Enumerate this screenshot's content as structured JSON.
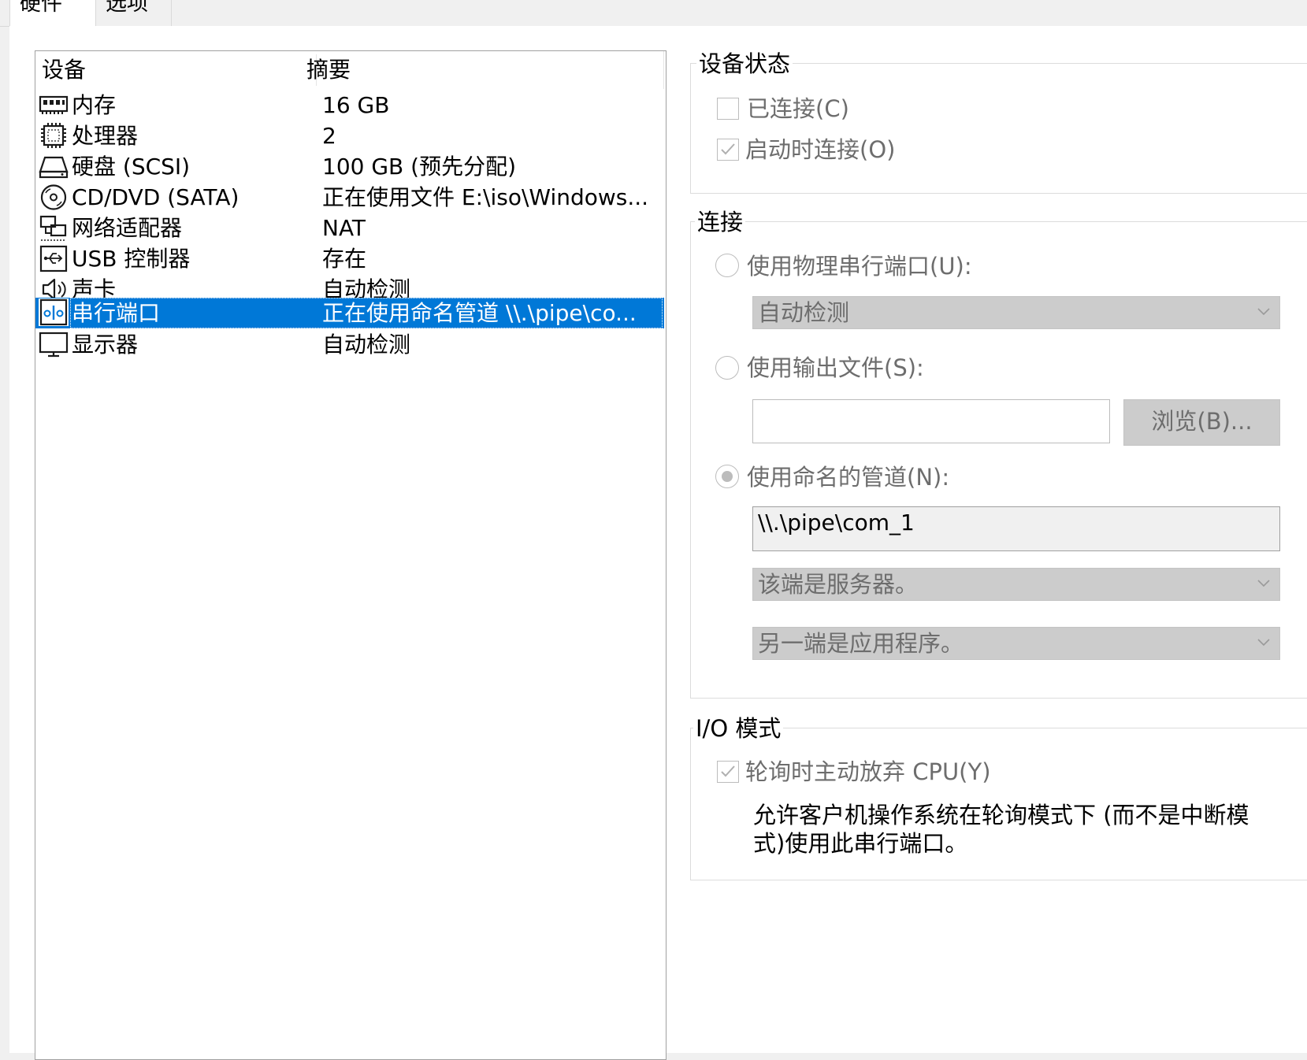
{
  "tabs": {
    "hardware": "硬件",
    "options": "选项"
  },
  "device_list": {
    "col_device": "设备",
    "col_summary": "摘要",
    "items": [
      {
        "name": "内存",
        "summary": "16 GB",
        "icon": "memory-icon"
      },
      {
        "name": "处理器",
        "summary": "2",
        "icon": "processor-icon"
      },
      {
        "name": "硬盘 (SCSI)",
        "summary": "100 GB (预先分配)",
        "icon": "hard-disk-icon"
      },
      {
        "name": "CD/DVD (SATA)",
        "summary": "正在使用文件 E:\\iso\\Windows...",
        "icon": "cd-dvd-icon"
      },
      {
        "name": "网络适配器",
        "summary": "NAT",
        "icon": "network-adapter-icon"
      },
      {
        "name": "USB 控制器",
        "summary": "存在",
        "icon": "usb-icon"
      },
      {
        "name": "声卡",
        "summary": "自动检测",
        "icon": "speaker-icon"
      },
      {
        "name": "串行端口",
        "summary": "正在使用命名管道 \\\\.\\pipe\\co...",
        "icon": "serial-port-icon",
        "selected": true
      },
      {
        "name": "显示器",
        "summary": "自动检测",
        "icon": "display-icon"
      }
    ]
  },
  "device_status": {
    "legend": "设备状态",
    "connected": {
      "label": "已连接(C)",
      "checked": false
    },
    "connect_at_power_on": {
      "label": "启动时连接(O)",
      "checked": true
    }
  },
  "connection": {
    "legend": "连接",
    "physical_port": {
      "label": "使用物理串行端口(U):",
      "selected": false,
      "combo_value": "自动检测"
    },
    "output_file": {
      "label": "使用输出文件(S):",
      "selected": false,
      "path": "",
      "browse_label": "浏览(B)..."
    },
    "named_pipe": {
      "label": "使用命名的管道(N):",
      "selected": true,
      "pipe_name": "\\\\.\\pipe\\com_1",
      "this_end": "该端是服务器。",
      "other_end": "另一端是应用程序。"
    }
  },
  "io_mode": {
    "legend": "I/O 模式",
    "yield_cpu": {
      "label": "轮询时主动放弃 CPU(Y)",
      "checked": true
    },
    "description_line1": "允许客户机操作系统在轮询模式下 (而不是中断模",
    "description_line2": "式)使用此串行端口。"
  },
  "colors": {
    "selection": "#0078d7",
    "disabled_text": "#6d6d6d",
    "disabled_fill": "#cccccc"
  }
}
